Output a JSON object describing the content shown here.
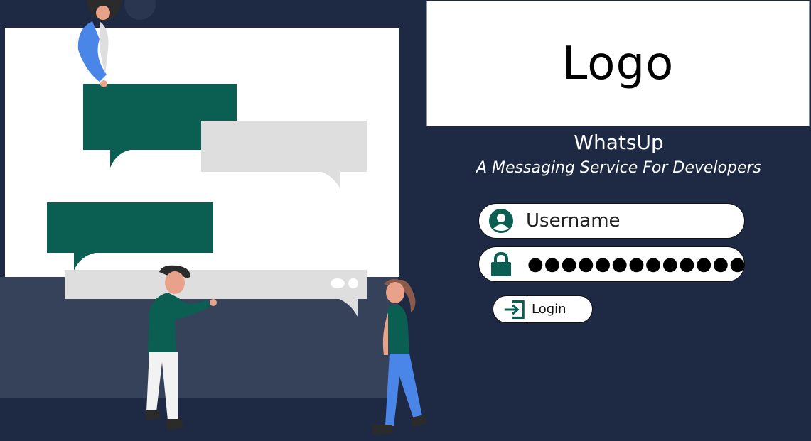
{
  "logo": {
    "text": "Logo"
  },
  "app": {
    "title": "WhatsUp",
    "subtitle": "A Messaging Service For Developers"
  },
  "form": {
    "username_placeholder": "Username",
    "password_masked": "●●●●●●●●●●●●●",
    "login_label": "Login"
  },
  "icons": {
    "user": "user-icon",
    "lock": "lock-icon",
    "login": "login-icon"
  },
  "colors": {
    "background": "#1e2a44",
    "accent_green": "#0b5e52",
    "bubble_grey": "#dedede",
    "person_blue": "#4a86e8"
  }
}
